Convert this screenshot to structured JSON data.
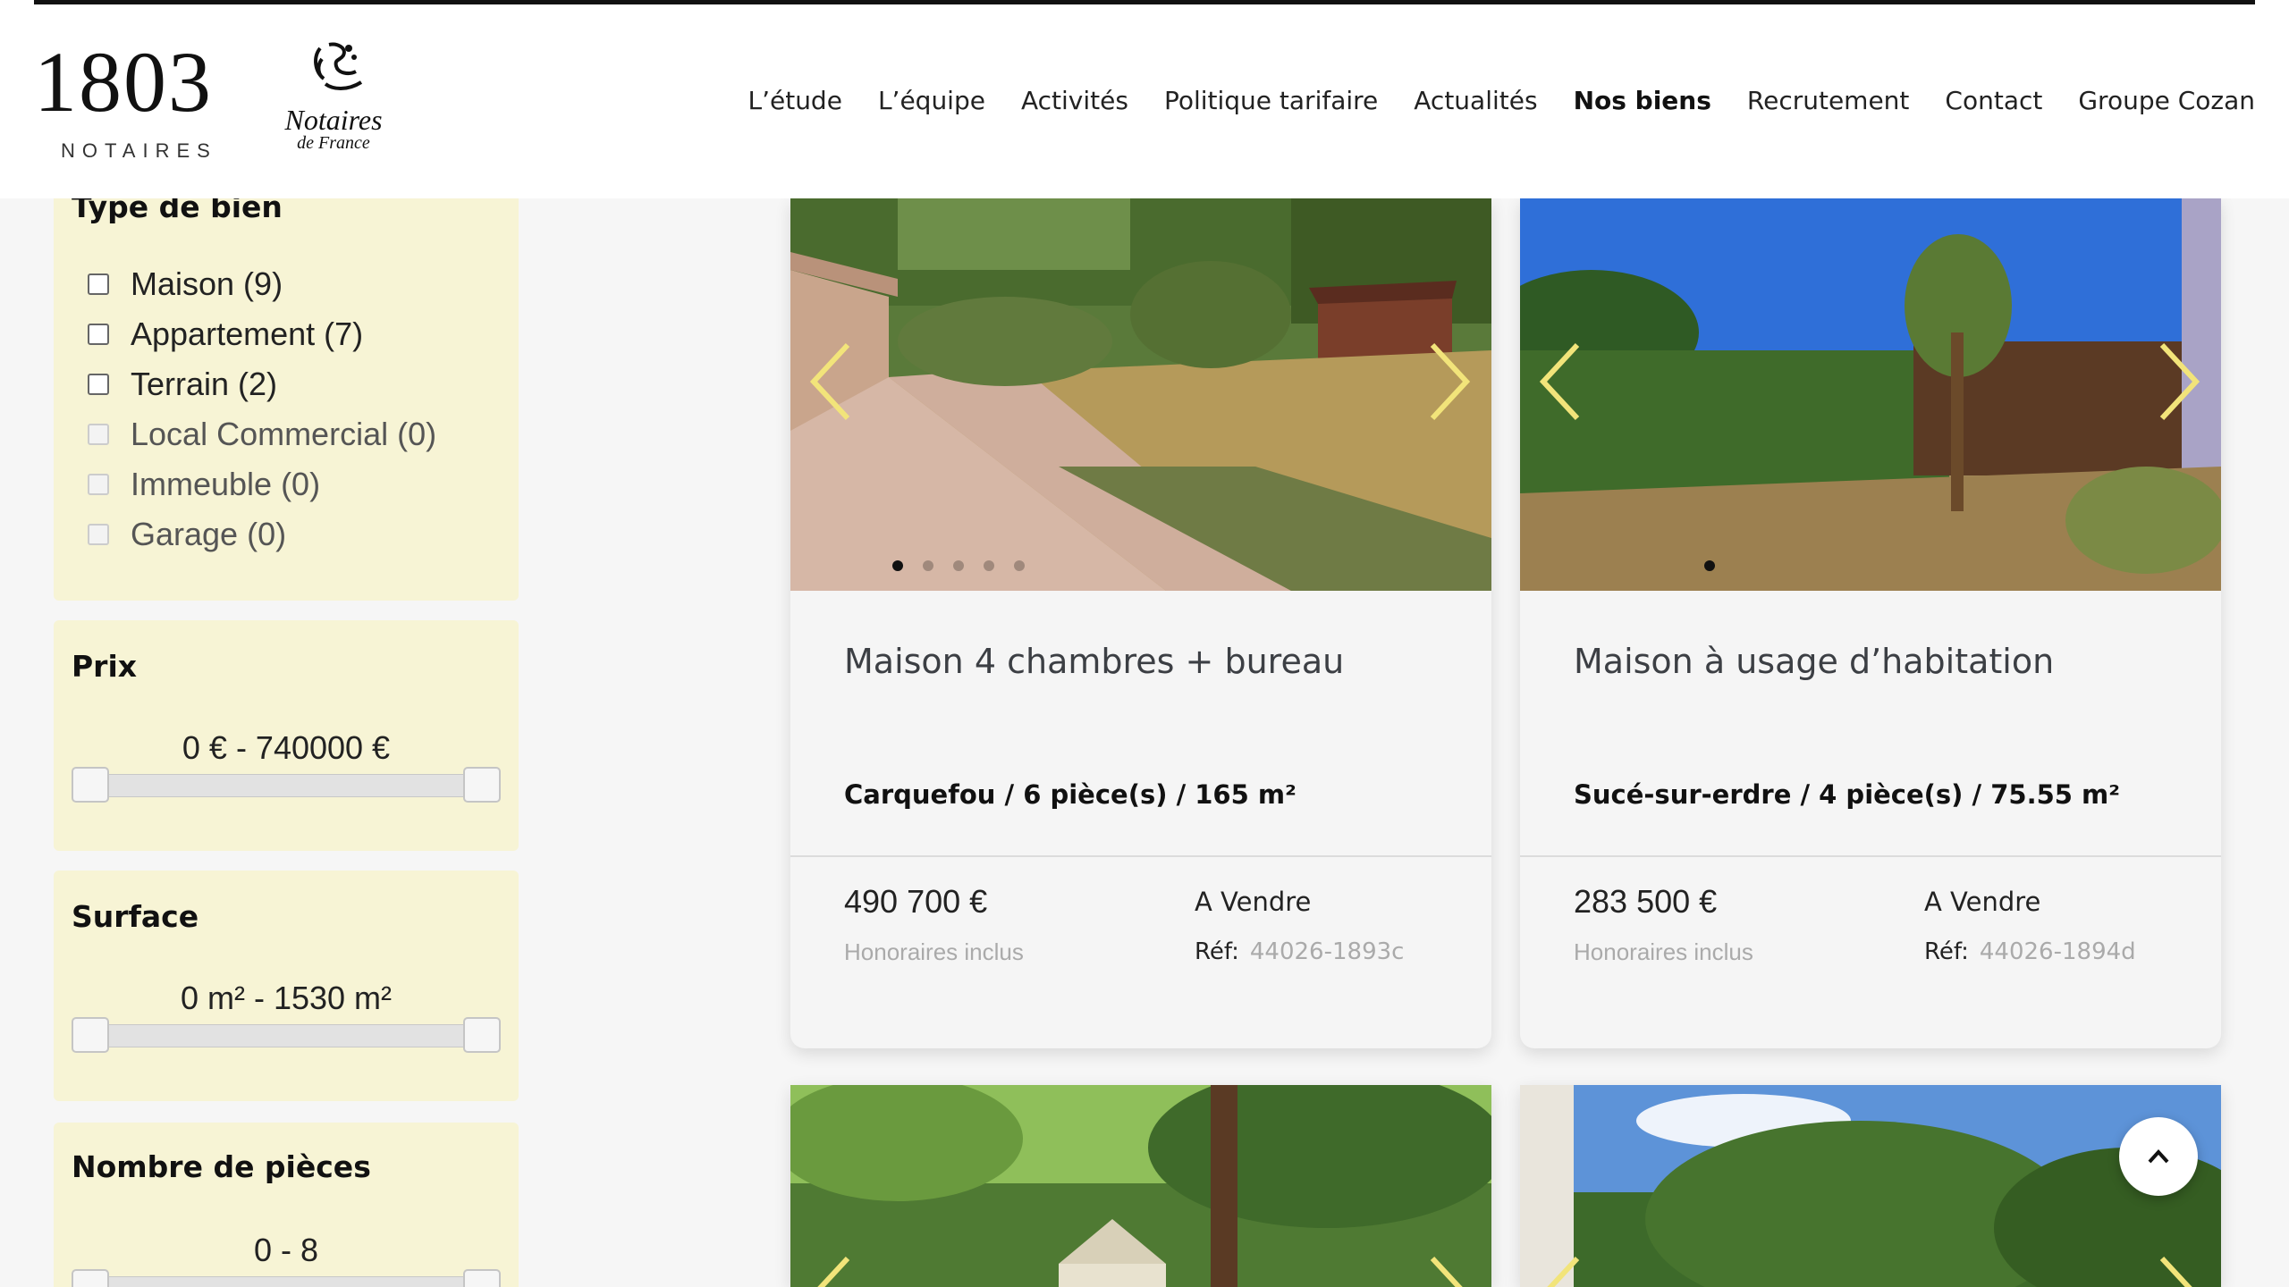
{
  "brand": {
    "logo_number": "1803",
    "logo_subtitle": "NOTAIRES",
    "partner_title": "Notaires",
    "partner_subtitle": "de France"
  },
  "nav": {
    "items": [
      "L’étude",
      "L’équipe",
      "Activités",
      "Politique tarifaire",
      "Actualités",
      "Nos biens",
      "Recrutement",
      "Contact",
      "Groupe Cozan"
    ],
    "active": "Nos biens"
  },
  "filters": {
    "type": {
      "title": "Type de bien",
      "options": [
        {
          "label": "Maison (9)",
          "enabled": true
        },
        {
          "label": "Appartement (7)",
          "enabled": true
        },
        {
          "label": "Terrain (2)",
          "enabled": true
        },
        {
          "label": "Local Commercial (0)",
          "enabled": false
        },
        {
          "label": "Immeuble (0)",
          "enabled": false
        },
        {
          "label": "Garage (0)",
          "enabled": false
        }
      ]
    },
    "price": {
      "title": "Prix",
      "range_text": "0 € - 740000 €",
      "min": 0,
      "max": 740000
    },
    "surface": {
      "title": "Surface",
      "range_text": "0 m² - 1530 m²",
      "min": 0,
      "max": 1530
    },
    "rooms": {
      "title": "Nombre de pièces",
      "range_text": "0 - 8",
      "min": 0,
      "max": 8
    }
  },
  "listings": [
    {
      "title": "Maison 4 chambres + bureau",
      "meta": "Carquefou / 6 pièce(s) / 165 m²",
      "price": "490 700 €",
      "fees": "Honoraires inclus",
      "status": "A Vendre",
      "ref_label": "Réf:",
      "ref": "44026-1893c",
      "photo_count": 5,
      "active_photo": 0
    },
    {
      "title": "Maison à usage d’habitation",
      "meta": "Sucé-sur-erdre / 4 pièce(s) / 75.55 m²",
      "price": "283 500 €",
      "fees": "Honoraires inclus",
      "status": "A Vendre",
      "ref_label": "Réf:",
      "ref": "44026-1894d",
      "photo_count": 1,
      "active_photo": 0
    }
  ],
  "colors": {
    "filter_bg": "#f7f4d5",
    "arrow": "#f2e47a",
    "card_bg": "#f5f5f5"
  },
  "icons": [
    "prev-arrow-icon",
    "next-arrow-icon",
    "chevron-up-icon",
    "checkbox-icon"
  ]
}
